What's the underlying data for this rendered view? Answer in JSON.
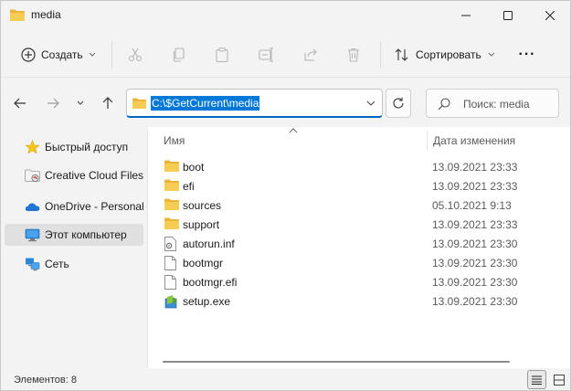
{
  "window": {
    "title": "media"
  },
  "toolbar": {
    "create_label": "Создать",
    "sort_label": "Сортировать",
    "more_label": "···",
    "icons": [
      "cut-icon",
      "copy-icon",
      "paste-icon",
      "rename-icon",
      "share-icon",
      "delete-icon"
    ]
  },
  "address": {
    "path": "C:\\$GetCurrent\\media"
  },
  "search": {
    "placeholder": "Поиск: media"
  },
  "sidebar": {
    "items": [
      {
        "label": "Быстрый доступ",
        "icon": "star-icon"
      },
      {
        "label": "Creative Cloud Files",
        "icon": "creative-cloud-icon"
      },
      {
        "label": "OneDrive - Personal",
        "icon": "onedrive-icon"
      },
      {
        "label": "Этот компьютер",
        "icon": "computer-icon",
        "selected": true
      },
      {
        "label": "Сеть",
        "icon": "network-icon"
      }
    ]
  },
  "columns": {
    "name": "Имя",
    "date": "Дата изменения"
  },
  "files": [
    {
      "name": "boot",
      "date": "13.09.2021 23:33",
      "type": "folder"
    },
    {
      "name": "efi",
      "date": "13.09.2021 23:33",
      "type": "folder"
    },
    {
      "name": "sources",
      "date": "05.10.2021 9:13",
      "type": "folder"
    },
    {
      "name": "support",
      "date": "13.09.2021 23:33",
      "type": "folder"
    },
    {
      "name": "autorun.inf",
      "date": "13.09.2021 23:30",
      "type": "config-file"
    },
    {
      "name": "bootmgr",
      "date": "13.09.2021 23:30",
      "type": "file"
    },
    {
      "name": "bootmgr.efi",
      "date": "13.09.2021 23:30",
      "type": "file"
    },
    {
      "name": "setup.exe",
      "date": "13.09.2021 23:30",
      "type": "exe"
    }
  ],
  "status": {
    "count_text": "Элементов: 8"
  },
  "colors": {
    "accent": "#0067c0",
    "selection": "#0078d7",
    "folder": "#f4c542"
  }
}
